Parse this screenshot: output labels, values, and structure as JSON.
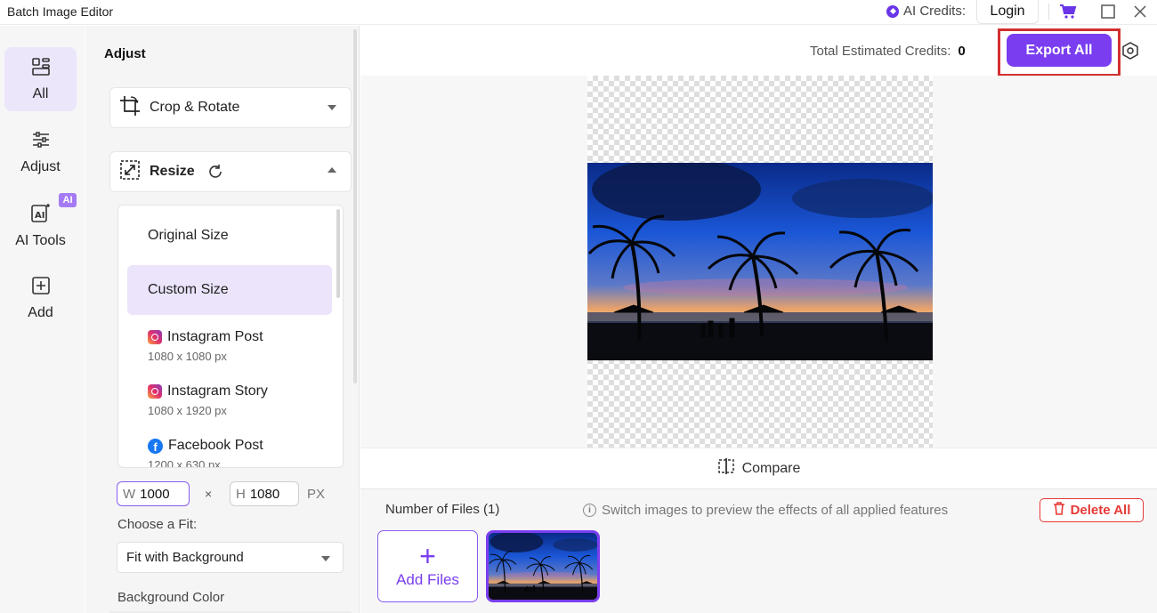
{
  "window": {
    "title": "Batch Image Editor",
    "ai_credits_label": "AI Credits:",
    "login_label": "Login"
  },
  "rail": {
    "items": [
      {
        "label": "All",
        "icon": "grid-icon",
        "active": true
      },
      {
        "label": "Adjust",
        "icon": "sliders-icon",
        "active": false
      },
      {
        "label": "AI Tools",
        "icon": "ai-tools-icon",
        "active": false,
        "badge": "AI"
      },
      {
        "label": "Add",
        "icon": "plus-square-icon",
        "active": false
      }
    ]
  },
  "panel": {
    "title": "Adjust",
    "crop_label": "Crop & Rotate",
    "resize_label": "Resize",
    "sizes": [
      {
        "label": "Original Size",
        "sub": "",
        "selected": false
      },
      {
        "label": "Custom Size",
        "sub": "",
        "selected": true
      },
      {
        "label": "Instagram Post",
        "sub": "1080 x 1080 px",
        "icon": "instagram-icon"
      },
      {
        "label": "Instagram Story",
        "sub": "1080 x 1920 px",
        "icon": "instagram-icon"
      },
      {
        "label": "Facebook Post",
        "sub": "1200 x 630 px",
        "icon": "facebook-icon"
      }
    ],
    "width_prefix": "W",
    "width_value": "1000",
    "times": "×",
    "height_prefix": "H",
    "height_value": "1080",
    "unit": "PX",
    "fit_label": "Choose a Fit:",
    "fit_value": "Fit with Background",
    "bg_color_label": "Background Color"
  },
  "main": {
    "est_label": "Total Estimated Credits:",
    "est_value": "0",
    "export_label": "Export All",
    "compare_label": "Compare",
    "files_label": "Number of Files (1)",
    "hint": "Switch images to preview the effects of all applied features",
    "delete_label": "Delete All",
    "add_files_label": "Add Files"
  },
  "colors": {
    "accent": "#7a3ef0",
    "highlight_frame": "#d32f2f",
    "delete": "#e53935"
  }
}
